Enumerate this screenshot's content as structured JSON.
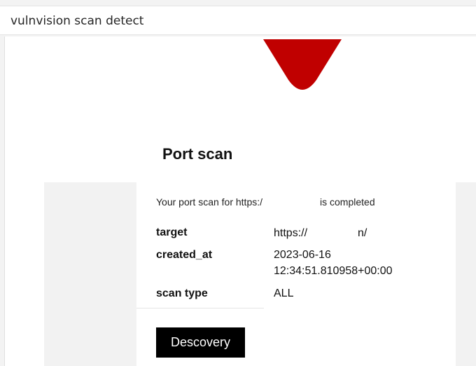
{
  "window": {
    "title": "vulnvision scan detect"
  },
  "logo": {
    "icon": "brand-logo-icon",
    "color": "#c00000"
  },
  "email": {
    "heading": "Port scan",
    "intro_prefix": "Your port scan for https:/",
    "intro_suffix": "is completed",
    "details": [
      {
        "label": "target",
        "value_prefix": "https://",
        "value_suffix": "n/"
      },
      {
        "label": "created_at",
        "value_line1": "2023-06-16",
        "value_line2": "12:34:51.810958+00:00"
      },
      {
        "label": "scan type",
        "value": "ALL"
      }
    ],
    "button_label": "Descovery"
  }
}
